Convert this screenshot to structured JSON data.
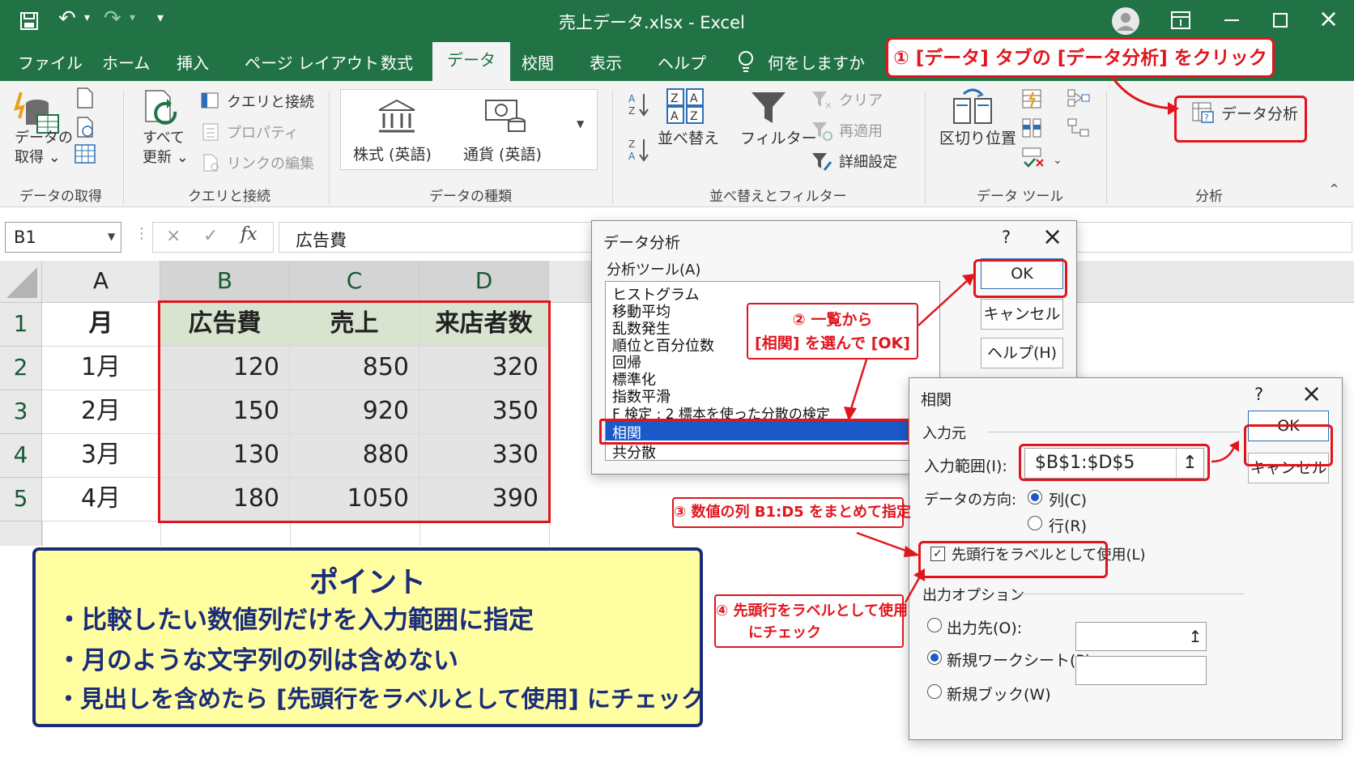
{
  "titlebar": {
    "filename": "売上データ.xlsx  -  Excel"
  },
  "tabs": [
    "ファイル",
    "ホーム",
    "挿入",
    "ページ レイアウト",
    "数式",
    "データ",
    "校閲",
    "表示",
    "ヘルプ"
  ],
  "tell_me": "何をしますか",
  "callout1": "① [データ] タブの [データ分析] をクリック",
  "ribbon": {
    "get_data": [
      "データの",
      "取得 ⌄"
    ],
    "refresh_all": [
      "すべて",
      "更新 ⌄"
    ],
    "queries_conn": "クエリと接続",
    "properties": "プロパティ",
    "edit_links": "リンクの編集",
    "stocks": "株式 (英語)",
    "currency": "通貨 (英語)",
    "sort": "並べ替え",
    "filter": "フィルター",
    "clear": "クリア",
    "reapply": "再適用",
    "advanced": "詳細設定",
    "text_to_columns": "区切り位置",
    "data_analysis": "データ分析",
    "groups": [
      "データの取得",
      "クエリと接続",
      "データの種類",
      "並べ替えとフィルター",
      "データ ツール",
      "分析"
    ]
  },
  "formula": {
    "namebox": "B1",
    "content": "広告費"
  },
  "sheet": {
    "columns": [
      "A",
      "B",
      "C",
      "D"
    ],
    "rows": [
      "1",
      "2",
      "3",
      "4",
      "5"
    ],
    "header": [
      "月",
      "広告費",
      "売上",
      "来店者数"
    ],
    "data": [
      [
        "1月",
        "120",
        "850",
        "320"
      ],
      [
        "2月",
        "150",
        "920",
        "350"
      ],
      [
        "3月",
        "130",
        "880",
        "330"
      ],
      [
        "4月",
        "180",
        "1050",
        "390"
      ]
    ]
  },
  "dialog_analysis": {
    "title": "データ分析",
    "help": "?",
    "list_label": "分析ツール(A)",
    "items": [
      "ヒストグラム",
      "移動平均",
      "乱数発生",
      "順位と百分位数",
      "回帰",
      "標準化",
      "指数平滑",
      "F 検定 : 2 標本を使った分散の検定",
      "相関",
      "共分散"
    ],
    "selected": "相関",
    "ok": "OK",
    "cancel": "キャンセル",
    "helpbtn": "ヘルプ(H)"
  },
  "callout2": [
    "② 一覧から",
    "[相関] を選んで [OK]"
  ],
  "dialog_corr": {
    "title": "相関",
    "help": "?",
    "input_section": "入力元",
    "input_range_label": "入力範囲(I):",
    "input_range": "$B$1:$D$5",
    "direction_label": "データの方向:",
    "col": "列(C)",
    "row": "行(R)",
    "labels_first_row": "先頭行をラベルとして使用(L)",
    "output_section": "出力オプション",
    "output_range": "出力先(O):",
    "new_sheet": "新規ワークシート(P):",
    "new_book": "新規ブック(W)",
    "ok": "OK",
    "cancel": "キャンセル"
  },
  "callout3": "③ 数値の列 B1:D5 をまとめて指定",
  "callout4": [
    "④ 先頭行をラベルとして使用",
    "にチェック"
  ],
  "point": {
    "title": "ポイント",
    "items": [
      "・比較したい数値列だけを入力範囲に指定",
      "・月のような文字列の列は含めない",
      "・見出しを含めたら [先頭行をラベルとして使用] にチェック"
    ]
  },
  "colors": {
    "excel_green": "#217346",
    "accent_red": "#e0161e",
    "point_bg": "#ffffa2",
    "point_text": "#1a2c7a",
    "selection_blue": "#1a59c9"
  }
}
